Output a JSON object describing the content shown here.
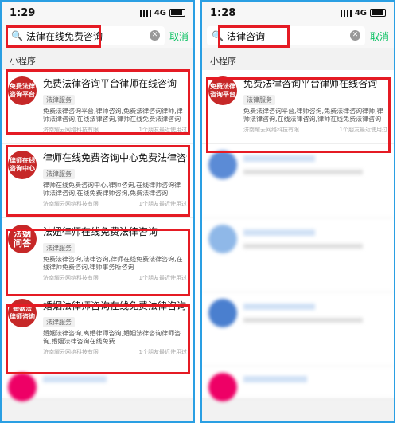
{
  "left": {
    "time": "1:29",
    "network": "4G",
    "query": "法律在线免费咨询",
    "cancel": "取消",
    "section": "小程序",
    "results": [
      {
        "logo": "免费法律\n咨询平台",
        "title": "免费法律咨询平台律师在线咨询",
        "tag": "法律服务",
        "desc": "免费法律咨询平台,律师咨询,免费法律咨询律师,律师法律咨询,在线法律咨询,律师在线免费法律咨询",
        "company": "济南耀云网络科技有限",
        "friends": "1个朋友最近使用过"
      },
      {
        "logo": "律师在线\n咨询中心",
        "title": "律师在线免费咨询中心免费法律咨询",
        "tag": "法律服务",
        "desc": "律师在线免费咨询中心,律师咨询,在线律师咨询律师法律咨询,在线免费律师咨询,免费法律咨询",
        "company": "济南耀云网络科技有限",
        "friends": "1个朋友最近使用过"
      },
      {
        "logo": "法姻\n问答",
        "title": "法妞律师在线免费法律咨询",
        "tag": "法律服务",
        "desc": "免费法律咨询,法律咨询,律师在线免费法律咨询,在线律师免费咨询,律师事务所咨询",
        "company": "济南耀云网络科技有限",
        "friends": "1个朋友最近使用过"
      },
      {
        "logo": "婚姻法\n律师咨询",
        "title": "婚姻法律师咨询在线免费法律咨询",
        "tag": "法律服务",
        "desc": "婚姻法律咨询,离婚律师咨询,婚姻法律咨询律师咨询,婚姻法律咨询在线免费",
        "company": "济南耀云网络科技有限",
        "friends": "1个朋友最近使用过"
      }
    ]
  },
  "right": {
    "time": "1:28",
    "network": "4G",
    "query": "法律咨询",
    "cancel": "取消",
    "section": "小程序",
    "results": [
      {
        "logo": "免费法律\n咨询平台",
        "title": "免费法律咨询平台律师在线咨询",
        "tag": "法律服务",
        "desc": "免费法律咨询平台,律师咨询,免费法律咨询律师,律师法律咨询,在线法律咨询,律师在线免费法律咨询",
        "company": "济南耀云网络科技有限",
        "friends": "1个朋友最近使用过"
      }
    ]
  },
  "colors": {
    "accent": "#07c160",
    "highlight": "#e51b24",
    "border": "#2a9fe3",
    "logo": "#c62828"
  }
}
